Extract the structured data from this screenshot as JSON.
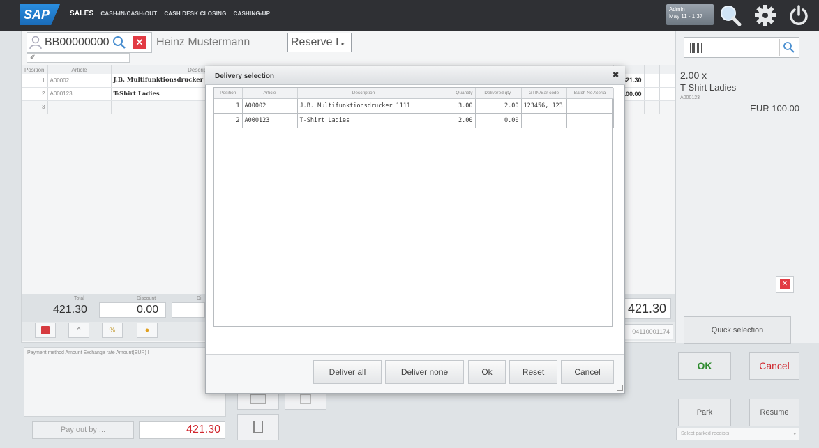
{
  "topbar": {
    "logo": "SAP",
    "nav": [
      "SALES",
      "CASH-IN/CASH-OUT",
      "CASH DESK CLOSING",
      "CASHING-UP"
    ],
    "user": "Admin",
    "datetime": "May 11 - 1:37"
  },
  "customer": {
    "id": "BB00000000",
    "name": "Heinz Mustermann",
    "reserve": "Reserve I"
  },
  "items": {
    "columns": [
      "Position",
      "Article",
      "Descript",
      "ount"
    ],
    "rows": [
      {
        "pos": "1",
        "article": "A00002",
        "desc": "J.B. Multifunktionsdrucker",
        "amount": "321.30"
      },
      {
        "pos": "2",
        "article": "A000123",
        "desc": "T-Shirt Ladies",
        "amount": "100.00"
      },
      {
        "pos": "3",
        "article": "",
        "desc": "",
        "amount": ""
      }
    ]
  },
  "totals": {
    "total_label": "Total",
    "total": "421.30",
    "discount_label": "Discount",
    "discount": "0.00",
    "di_label": "Di",
    "grand": "421.30",
    "receipt": "04110001174"
  },
  "payment": {
    "columns": "Payment method     Amount     Exchange rate  Amount(EUR)  I",
    "payout_label": "Pay out by ...",
    "amount": "421.30"
  },
  "right": {
    "qty": "2.00 x",
    "article": "T-Shirt Ladies",
    "code": "A000123",
    "price": "EUR 100.00",
    "quick_selection": "Quick selection",
    "ok": "OK",
    "cancel": "Cancel",
    "park": "Park",
    "resume": "Resume",
    "parked_placeholder": "Select parked receipts"
  },
  "modal": {
    "title": "Delivery selection",
    "columns": [
      "Position",
      "Article",
      "Description",
      "Quantity",
      "Delivered qty.",
      "GTIN/Bar code",
      "Batch No./Seria"
    ],
    "rows": [
      {
        "pos": "1",
        "article": "A00002",
        "desc": "J.B. Multifunktionsdrucker 1111",
        "qty": "3.00",
        "delivered": "2.00",
        "gtin": "123456, 123",
        "batch": ""
      },
      {
        "pos": "2",
        "article": "A000123",
        "desc": "T-Shirt Ladies",
        "qty": "2.00",
        "delivered": "0.00",
        "gtin": "",
        "batch": ""
      }
    ],
    "buttons": {
      "deliver_all": "Deliver all",
      "deliver_none": "Deliver none",
      "ok": "Ok",
      "reset": "Reset",
      "cancel": "Cancel"
    }
  }
}
